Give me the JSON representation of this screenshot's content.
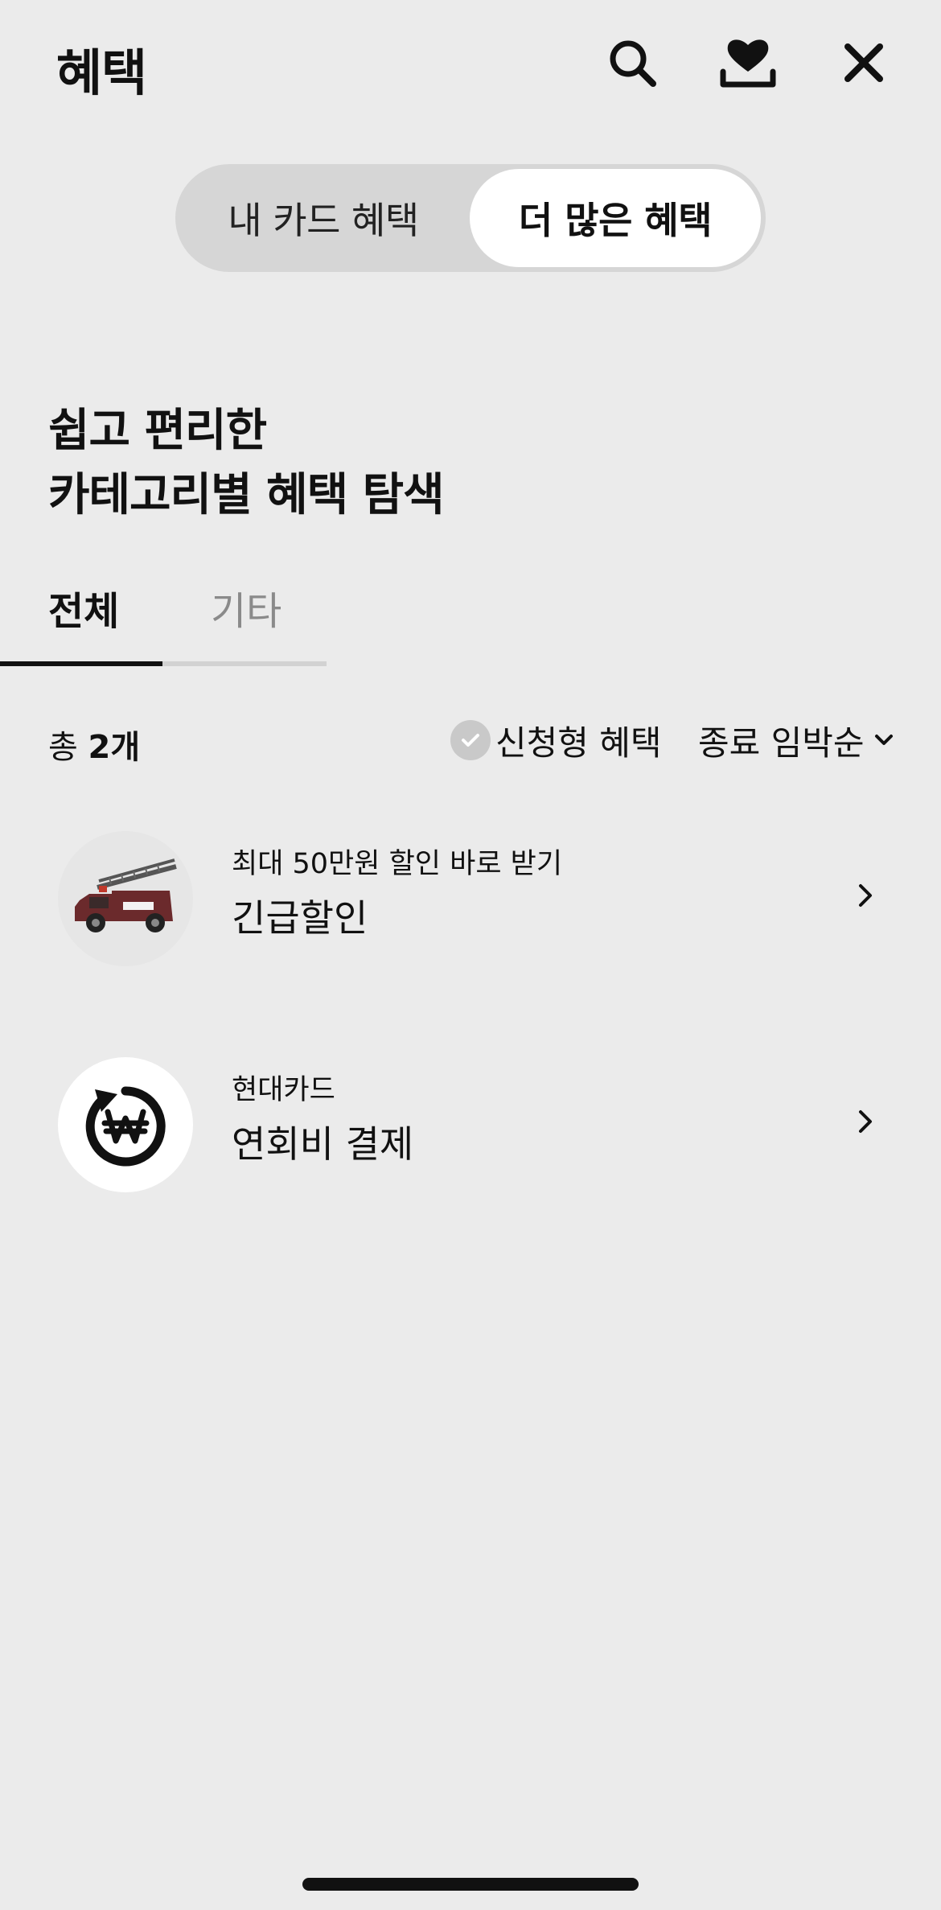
{
  "header": {
    "title": "혜택",
    "icons": [
      "search-icon",
      "heart-download-icon",
      "close-icon"
    ]
  },
  "segment": {
    "tabs": [
      {
        "label": "내 카드 혜택",
        "active": false
      },
      {
        "label": "더 많은 혜택",
        "active": true
      }
    ]
  },
  "section": {
    "title_line1": "쉽고 편리한",
    "title_line2": "카테고리별 혜택 탐색"
  },
  "category_tabs": [
    {
      "label": "전체",
      "active": true
    },
    {
      "label": "기타",
      "active": false
    }
  ],
  "filter": {
    "count_prefix": "총",
    "count_value": "2개",
    "apply_label": "신청형 혜택",
    "sort_label": "종료 임박순"
  },
  "items": [
    {
      "subtitle": "최대 50만원 할인 바로 받기",
      "title": "긴급할인",
      "icon": "fire-truck-image"
    },
    {
      "subtitle": "현대카드",
      "title": "연회비 결제",
      "icon": "won-refresh-icon"
    }
  ],
  "colors": {
    "background": "#ebebeb",
    "segment_bg": "#d6d6d6",
    "active_segment": "#ffffff",
    "text": "#111111",
    "inactive_tab": "#8a8a8a"
  }
}
